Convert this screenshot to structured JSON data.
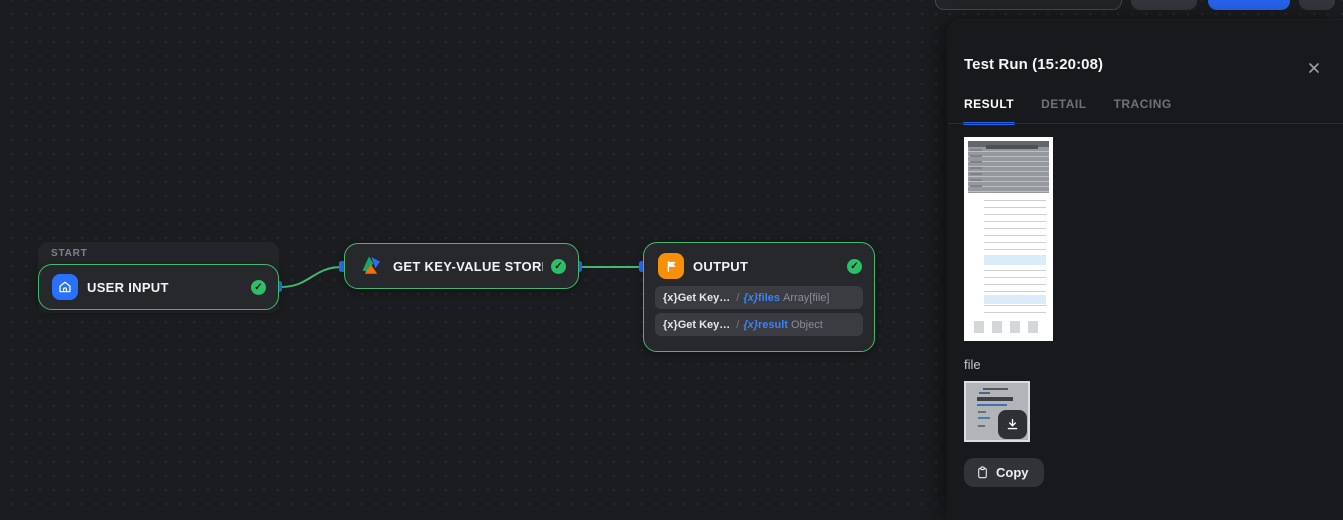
{
  "colors": {
    "accent_blue": "#2563eb",
    "handle_blue": "#2970ff",
    "success_green": "#42b873",
    "variable_blue": "#3b82f6",
    "user_input_icon_bg": "#2970ff",
    "output_icon_bg": "#f79009",
    "canvas_bg": "#1b1c1f",
    "panel_bg": "#18191c"
  },
  "canvas": {
    "start_group_label": "START",
    "nodes": {
      "user_input": {
        "title": "USER INPUT",
        "status_icon": "check"
      },
      "kv_store": {
        "title": "GET KEY-VALUE STORE RE",
        "status_icon": "check"
      },
      "output": {
        "title": "OUTPUT",
        "status_icon": "check",
        "variables": [
          {
            "source_prefix": "{x}",
            "source": "Get Key…",
            "separator": "/",
            "var_prefix": "{x}",
            "name": "files",
            "type": "Array[file]"
          },
          {
            "source_prefix": "{x}",
            "source": "Get Key…",
            "separator": "/",
            "var_prefix": "{x}",
            "name": "result",
            "type": "Object"
          }
        ]
      }
    }
  },
  "panel": {
    "title": "Test Run (15:20:08)",
    "tabs": [
      {
        "label": "RESULT",
        "active": true
      },
      {
        "label": "DETAIL",
        "active": false
      },
      {
        "label": "TRACING",
        "active": false
      }
    ],
    "file_section_label": "file",
    "copy_button_label": "Copy"
  }
}
